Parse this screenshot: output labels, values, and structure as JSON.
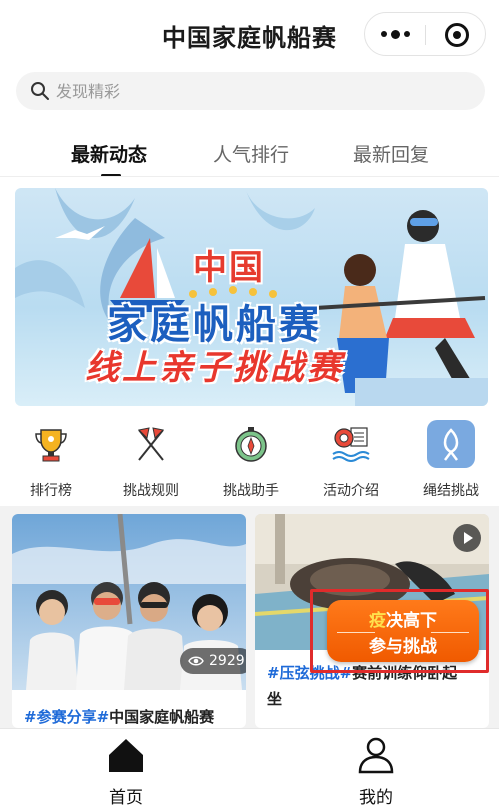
{
  "header": {
    "title": "中国家庭帆船赛",
    "more_icon": "more-dots-icon",
    "close_icon": "target-close-icon"
  },
  "search": {
    "placeholder": "发现精彩",
    "value": ""
  },
  "tabs": [
    {
      "label": "最新动态",
      "active": true
    },
    {
      "label": "人气排行",
      "active": false
    },
    {
      "label": "最新回复",
      "active": false
    }
  ],
  "banner": {
    "line1": "中国",
    "line2": "家庭帆船赛",
    "line3": "线上亲子挑战赛"
  },
  "quick_links": [
    {
      "label": "排行榜",
      "icon": "trophy-icon"
    },
    {
      "label": "挑战规则",
      "icon": "crossed-flags-icon"
    },
    {
      "label": "挑战助手",
      "icon": "compass-icon"
    },
    {
      "label": "活动介绍",
      "icon": "lifebuoy-icon"
    },
    {
      "label": "绳结挑战",
      "icon": "rope-knot-icon"
    }
  ],
  "cards": [
    {
      "tag": "#参赛分享#",
      "title": "中国家庭帆船赛",
      "views": "2929"
    },
    {
      "tag": "#压弦挑战#",
      "title": "赛前训练仰卧起",
      "title_line2": "坐",
      "has_video": true
    }
  ],
  "challenge_overlay": {
    "line1_highlight": "疫",
    "line1_rest": "决高下",
    "line2": "参与挑战"
  },
  "bottom_nav": [
    {
      "label": "首页",
      "icon": "home-icon",
      "active": true
    },
    {
      "label": "我的",
      "icon": "user-icon",
      "active": false
    }
  ],
  "colors": {
    "accent_blue": "#1e6ad8",
    "overlay_orange": "#f05a00",
    "frame_red": "#e02b2b"
  }
}
